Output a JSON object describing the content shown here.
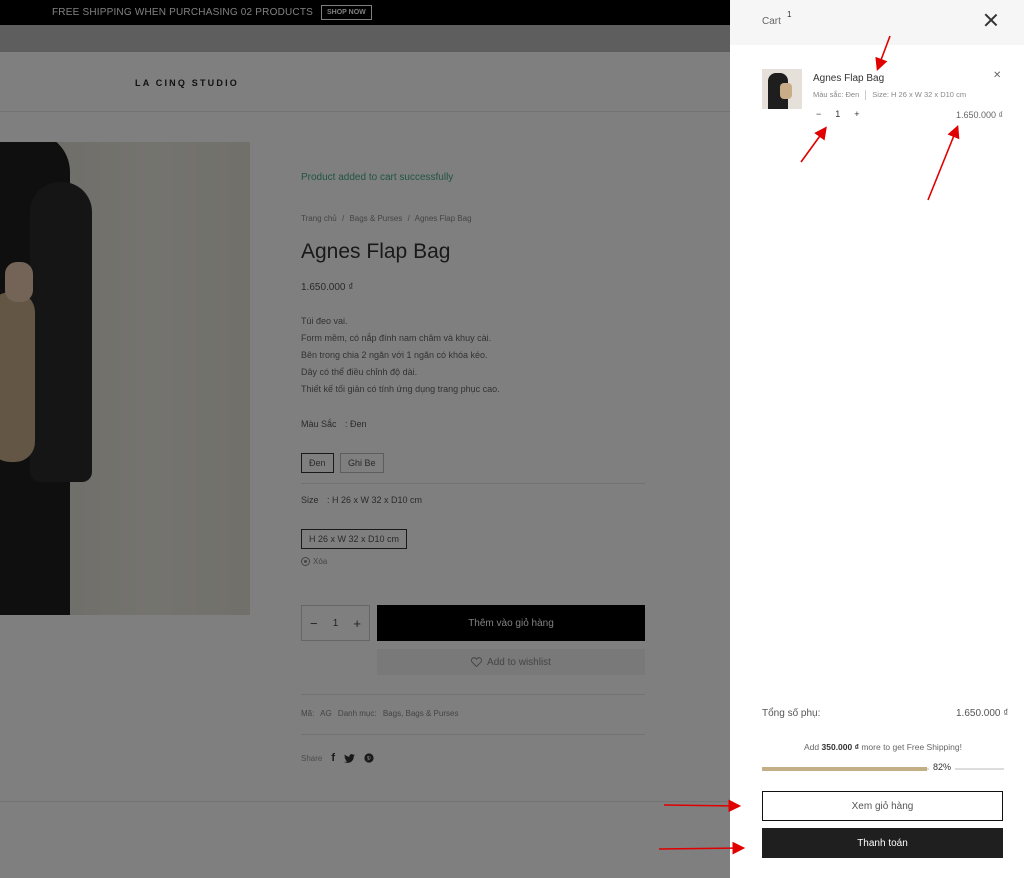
{
  "announcement": {
    "message": "FREE SHIPPING WHEN PURCHASING 02 PRODUCTS",
    "cta": "SHOP NOW"
  },
  "header": {
    "logo": "LA CINQ STUDIO"
  },
  "product": {
    "notice": "Product added to cart successfully",
    "breadcrumb": [
      "Trang chủ",
      "/",
      "Bags & Purses",
      "/",
      "Agnes Flap Bag"
    ],
    "title": "Agnes Flap Bag",
    "price": "1.650.000 ₫",
    "description": [
      "Túi đeo vai.",
      "Form mềm, có nắp đính nam châm và khuy cài.",
      "Bên trong chia 2 ngăn với 1 ngăn có khóa kéo.",
      "Dây có thể điều chỉnh độ dài.",
      "Thiết kế tối giản có tính ứng dụng trang phục cao."
    ],
    "color_label": "Màu Sắc",
    "color_selected": ": Đen",
    "color_options": [
      "Đen",
      "Ghi Be"
    ],
    "size_label": "Size",
    "size_selected": ": H 26 x W 32 x D10 cm",
    "size_options": [
      "H 26 x W 32 x D10 cm"
    ],
    "clear_label": "Xóa",
    "quantity": "1",
    "add_to_cart": "Thêm vào giỏ hàng",
    "wishlist": "Add to wishlist",
    "meta": {
      "sku_label": "Mã:",
      "sku": "AG",
      "category_label": "Danh mục:",
      "categories": "Bags, Bags & Purses"
    },
    "share_label": "Share",
    "social_icons": [
      "facebook-icon",
      "twitter-icon",
      "pinterest-icon"
    ]
  },
  "cart": {
    "title": "Cart",
    "count": "1",
    "item": {
      "name": "Agnes Flap Bag",
      "color": "Màu sắc: Đen",
      "size": "Size: H 26 x W 32 x D10 cm",
      "quantity": "1",
      "price": "1.650.000 ₫"
    },
    "subtotal_label": "Tổng số phụ:",
    "subtotal_value": "1.650.000 ₫",
    "shipping_prefix": "Add",
    "shipping_amount": "350.000 ₫",
    "shipping_suffix": "more to get Free Shipping!",
    "progress_fraction": 0.82,
    "progress_label": "82%",
    "view_cart": "Xem giỏ hàng",
    "checkout": "Thanh toán"
  },
  "colors": {
    "overlay": "rgba(0,0,0,0.5)",
    "notice": "#41a886",
    "progress_fill": "#c4ae86",
    "checkout_bg": "#1f1f1f",
    "annotation_arrow": "#e00000"
  }
}
